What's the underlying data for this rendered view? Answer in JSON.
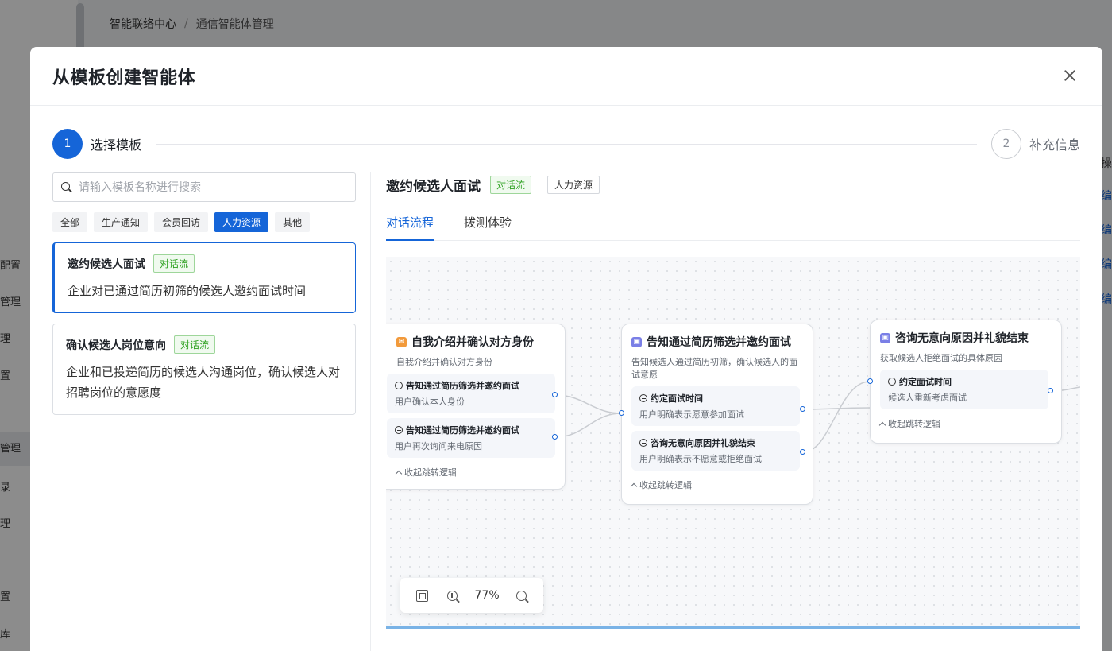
{
  "background": {
    "breadcrumb": [
      "智能联络中心",
      "通信智能体管理"
    ],
    "breadcrumb_sep": "/",
    "sidebar_items": [
      "配置",
      "管理",
      "理",
      "置",
      "管理",
      "录",
      "理",
      "置",
      "库"
    ],
    "right_column": [
      "操",
      "编",
      "编",
      "编",
      "编"
    ]
  },
  "modal": {
    "title": "从模板创建智能体",
    "steps": [
      {
        "number": "1",
        "label": "选择模板"
      },
      {
        "number": "2",
        "label": "补充信息"
      }
    ]
  },
  "left": {
    "search_placeholder": "请输入模板名称进行搜索",
    "filters": [
      "全部",
      "生产通知",
      "会员回访",
      "人力资源",
      "其他"
    ],
    "active_filter": "人力资源",
    "templates": [
      {
        "title": "邀约候选人面试",
        "tag": "对话流",
        "desc": "企业对已通过简历初筛的候选人邀约面试时间"
      },
      {
        "title": "确认候选人岗位意向",
        "tag": "对话流",
        "desc": "企业和已投递简历的候选人沟通岗位，确认候选人对招聘岗位的意愿度"
      }
    ]
  },
  "detail": {
    "title": "邀约候选人面试",
    "tag_type": "对话流",
    "tag_category": "人力资源",
    "tabs": [
      "对话流程",
      "拨测体验"
    ],
    "nodes": [
      {
        "icon": "orange-node-icon",
        "title": "自我介绍并确认对方身份",
        "desc": "自我介绍并确认对方身份",
        "branches": [
          {
            "title": "告知通过简历筛选并邀约面试",
            "sub": "用户确认本人身份"
          },
          {
            "title": "告知通过简历筛选并邀约面试",
            "sub": "用户再次询问来电原因"
          }
        ],
        "collapse": "收起跳转逻辑"
      },
      {
        "icon": "purple-node-icon",
        "title": "告知通过简历筛选并邀约面试",
        "desc": "告知候选人通过简历初筛，确认候选人的面试意愿",
        "branches": [
          {
            "title": "约定面试时间",
            "sub": "用户明确表示愿意参加面试"
          },
          {
            "title": "咨询无意向原因并礼貌结束",
            "sub": "用户明确表示不愿意或拒绝面试"
          }
        ],
        "collapse": "收起跳转逻辑"
      },
      {
        "icon": "purple-node-icon",
        "title": "咨询无意向原因并礼貌结束",
        "desc": "获取候选人拒绝面试的具体原因",
        "branches": [
          {
            "title": "约定面试时间",
            "sub": "候选人重新考虑面试"
          }
        ],
        "collapse": "收起跳转逻辑"
      }
    ],
    "zoom": "77%"
  },
  "colors": {
    "primary": "#1565d8",
    "tag_green": "#2ea121",
    "node_orange": "#f29a3b",
    "node_purple": "#7a7fe6"
  }
}
